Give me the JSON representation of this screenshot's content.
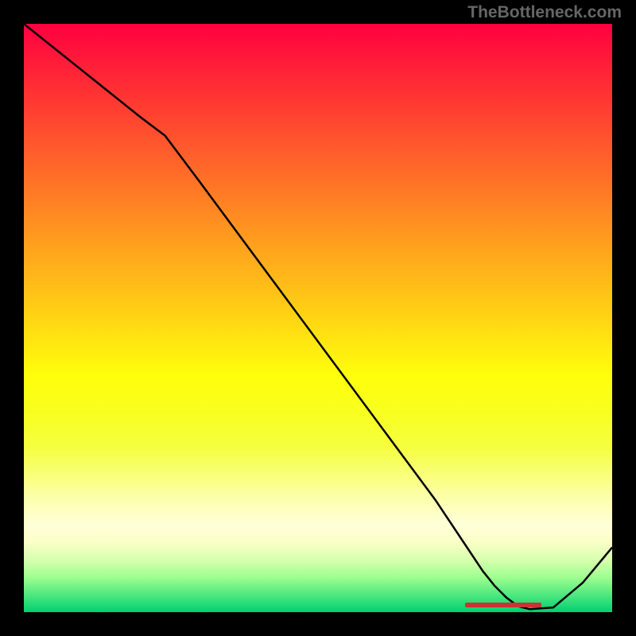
{
  "watermark": "TheBottleneck.com",
  "chart_data": {
    "type": "line",
    "title": "",
    "xlabel": "",
    "ylabel": "",
    "x": [
      0,
      10,
      20,
      24,
      30,
      40,
      50,
      60,
      70,
      76,
      78,
      80,
      82,
      84,
      86,
      90,
      95,
      100
    ],
    "y": [
      100,
      92,
      84,
      81,
      73,
      59.5,
      46,
      32.5,
      19,
      10,
      7,
      4.5,
      2.5,
      1,
      0.5,
      0.8,
      5,
      11
    ],
    "xlim": [
      0,
      100
    ],
    "ylim": [
      0,
      100
    ],
    "optimal_range": {
      "start": 75,
      "end": 88,
      "y": 1.2
    },
    "gradient_meaning": "vertical gradient from red (top, high bottleneck) to green (bottom, low bottleneck)"
  },
  "colors": {
    "background": "#000000",
    "curve": "#000000",
    "marker": "#cc3333",
    "watermark": "#666666"
  }
}
